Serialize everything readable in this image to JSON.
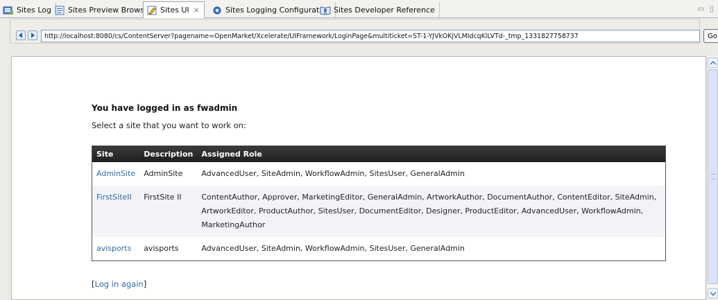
{
  "tabs": [
    {
      "label": "Sites Log",
      "icon": "log-icon"
    },
    {
      "label": "Sites Preview Browser",
      "icon": "preview-icon"
    },
    {
      "label": "Sites UI",
      "icon": "edit-icon",
      "active": true
    },
    {
      "label": "Sites Logging Configuration",
      "icon": "gear-icon"
    },
    {
      "label": "Sites Developer Reference",
      "icon": "book-icon"
    }
  ],
  "browser": {
    "url": "http://localhost:8080/cs/ContentServer?pagename=OpenMarket/Xcelerate/UIFramework/LoginPage&multiticket=ST-1-YJVkOKjVLMIdcqKlLVTd-_tmp_1331827758737",
    "go_label": "Go"
  },
  "page": {
    "heading": "You have logged in as fwadmin",
    "subheading": "Select a site that you want to work on:",
    "table": {
      "headers": [
        "Site",
        "Description",
        "Assigned Role"
      ],
      "rows": [
        {
          "site": "AdminSite",
          "description": "AdminSite",
          "roles": "AdvancedUser, SiteAdmin, WorkflowAdmin, SitesUser, GeneralAdmin"
        },
        {
          "site": "FirstSiteII",
          "description": "FirstSite II",
          "roles": "ContentAuthor, Approver, MarketingEditor, GeneralAdmin, ArtworkAuthor, DocumentAuthor, ContentEditor, SiteAdmin, ArtworkEditor, ProductAuthor, SitesUser, DocumentEditor, Designer, ProductEditor, AdvancedUser, WorkflowAdmin, MarketingAuthor"
        },
        {
          "site": "avisports",
          "description": "avisports",
          "roles": "AdvancedUser, SiteAdmin, WorkflowAdmin, SitesUser, GeneralAdmin"
        }
      ]
    },
    "relogin": {
      "open": "[",
      "link": "Log in again",
      "close": "]"
    }
  },
  "colors": {
    "link": "#2e6aa8",
    "table_header": "#2b2b2b",
    "row_alt": "#f2f3f7"
  }
}
